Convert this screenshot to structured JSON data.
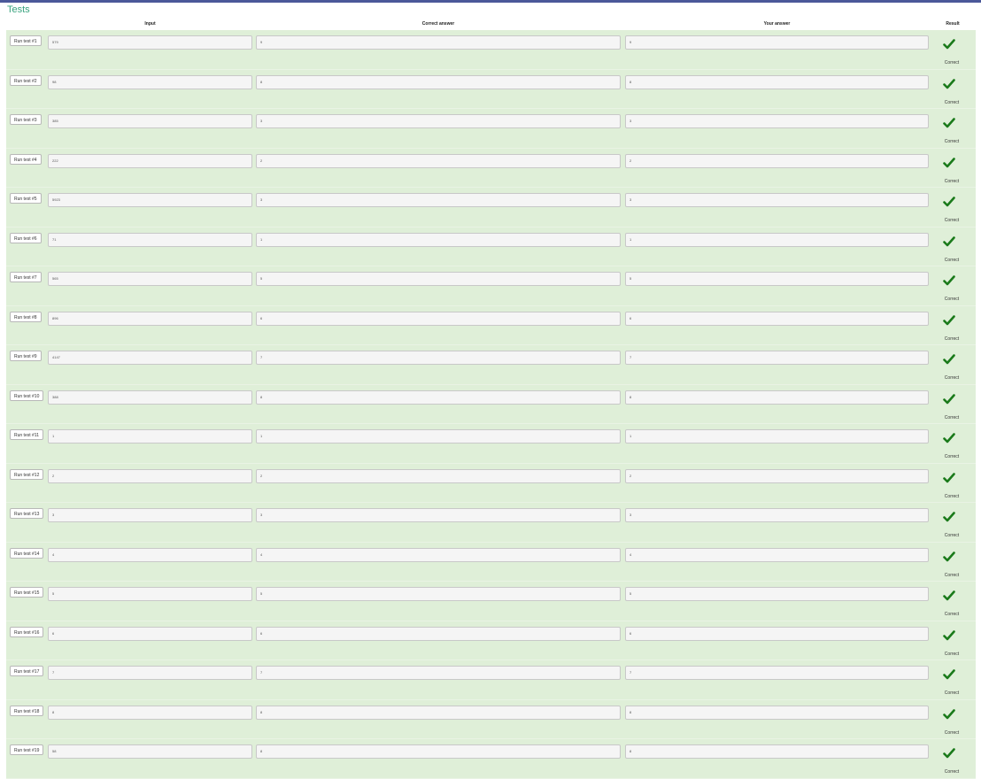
{
  "page": {
    "title": "Tests"
  },
  "headers": {
    "input": "Input",
    "correct": "Correct answer",
    "your": "Your answer",
    "result": "Result"
  },
  "colors": {
    "title": "#3aa37f",
    "row_bg": "#dfefd8",
    "check": "#1a7a1a",
    "topbar": "#4b5899"
  },
  "icons": {
    "result": "check-icon"
  },
  "tests": [
    {
      "button": "Run test #1",
      "input": "579",
      "correct": "9",
      "your": "9",
      "status": "Correct"
    },
    {
      "button": "Run test #2",
      "input": "98",
      "correct": "8",
      "your": "8",
      "status": "Correct"
    },
    {
      "button": "Run test #3",
      "input": "385",
      "correct": "3",
      "your": "3",
      "status": "Correct"
    },
    {
      "button": "Run test #4",
      "input": "222",
      "correct": "2",
      "your": "2",
      "status": "Correct"
    },
    {
      "button": "Run test #5",
      "input": "5923",
      "correct": "3",
      "your": "3",
      "status": "Correct"
    },
    {
      "button": "Run test #6",
      "input": "71",
      "correct": "1",
      "your": "1",
      "status": "Correct"
    },
    {
      "button": "Run test #7",
      "input": "565",
      "correct": "5",
      "your": "5",
      "status": "Correct"
    },
    {
      "button": "Run test #8",
      "input": "896",
      "correct": "6",
      "your": "6",
      "status": "Correct"
    },
    {
      "button": "Run test #9",
      "input": "4147",
      "correct": "7",
      "your": "7",
      "status": "Correct"
    },
    {
      "button": "Run test #10",
      "input": "388",
      "correct": "8",
      "your": "8",
      "status": "Correct"
    },
    {
      "button": "Run test #11",
      "input": "1",
      "correct": "1",
      "your": "1",
      "status": "Correct"
    },
    {
      "button": "Run test #12",
      "input": "2",
      "correct": "2",
      "your": "2",
      "status": "Correct"
    },
    {
      "button": "Run test #13",
      "input": "3",
      "correct": "3",
      "your": "3",
      "status": "Correct"
    },
    {
      "button": "Run test #14",
      "input": "4",
      "correct": "4",
      "your": "4",
      "status": "Correct"
    },
    {
      "button": "Run test #15",
      "input": "5",
      "correct": "5",
      "your": "5",
      "status": "Correct"
    },
    {
      "button": "Run test #16",
      "input": "6",
      "correct": "6",
      "your": "6",
      "status": "Correct"
    },
    {
      "button": "Run test #17",
      "input": "7",
      "correct": "7",
      "your": "7",
      "status": "Correct"
    },
    {
      "button": "Run test #18",
      "input": "8",
      "correct": "8",
      "your": "8",
      "status": "Correct"
    },
    {
      "button": "Run test #19",
      "input": "58",
      "correct": "8",
      "your": "8",
      "status": "Correct"
    }
  ]
}
